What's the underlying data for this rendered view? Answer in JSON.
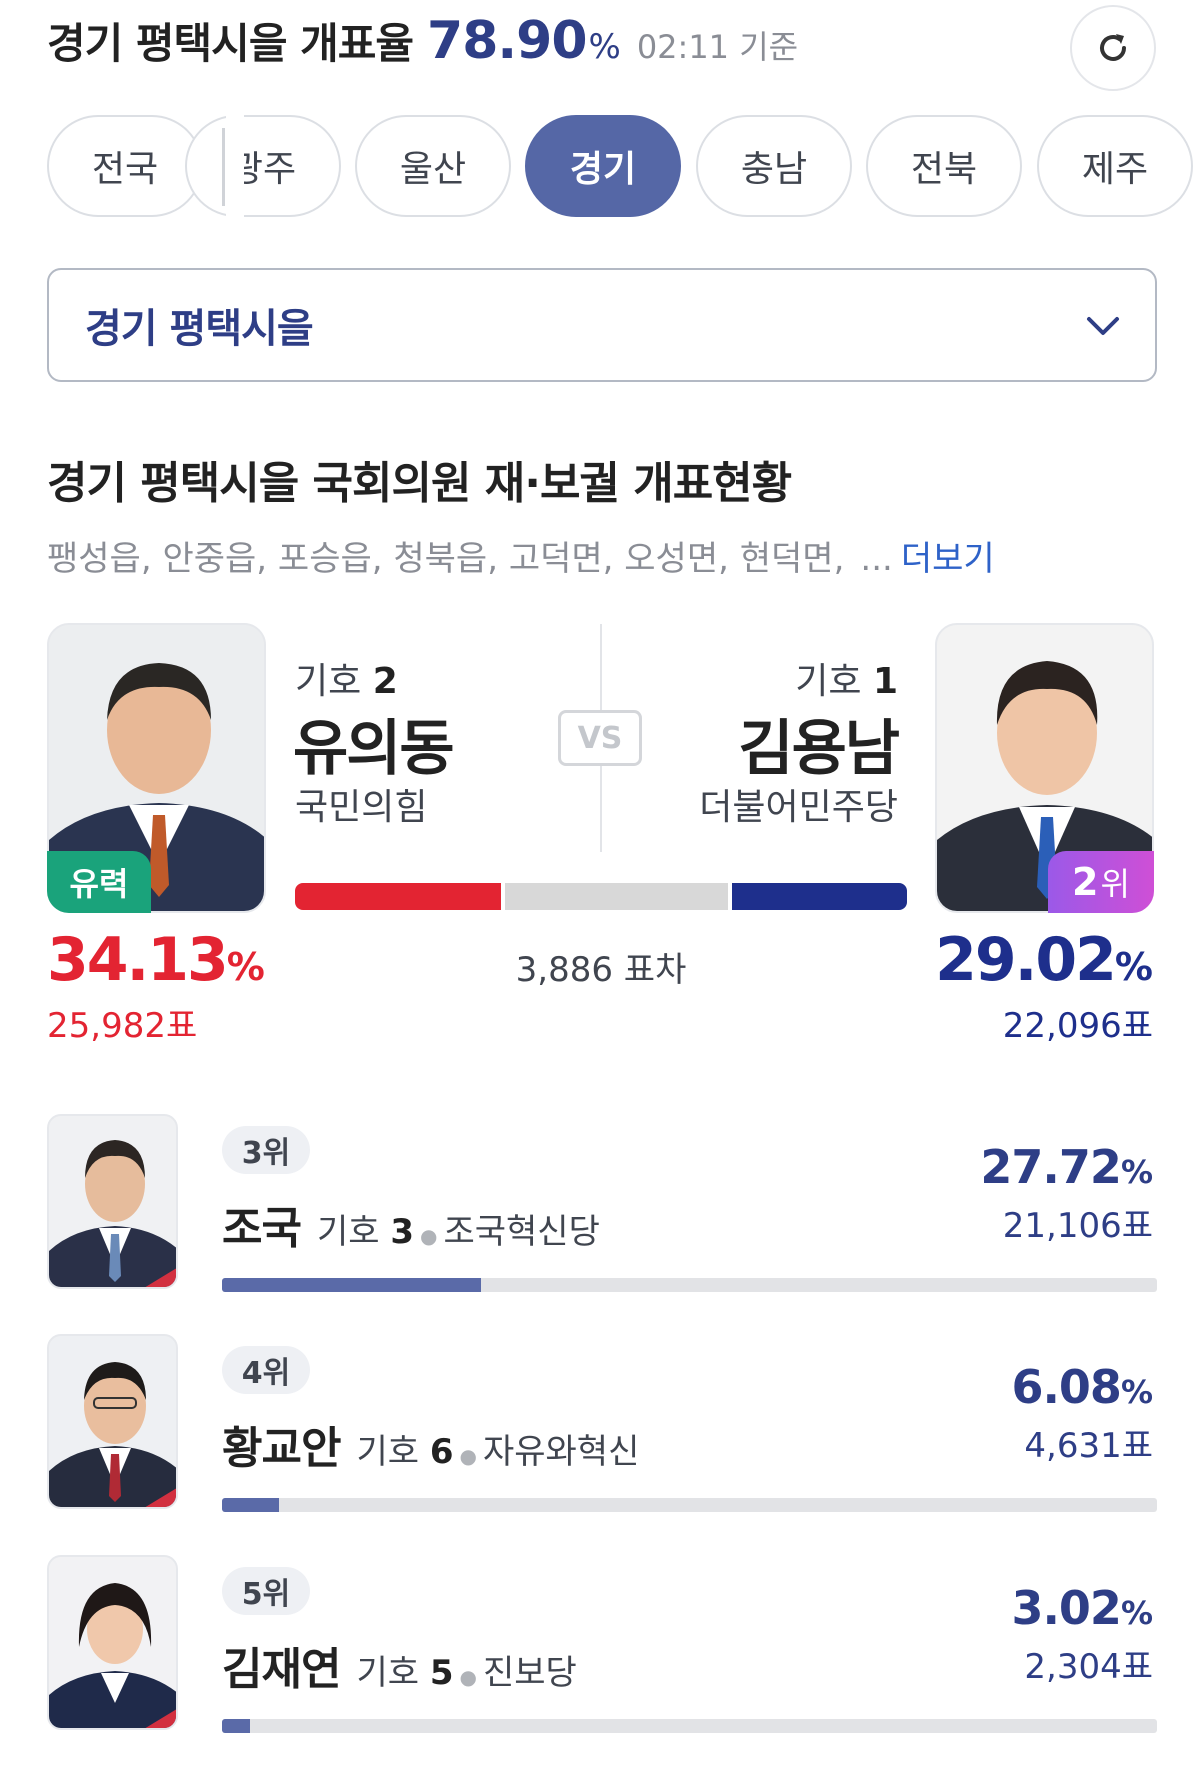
{
  "header": {
    "title": "경기 평택시을 개표율",
    "rate": "78.90",
    "rate_unit": "%",
    "time": "02:11 기준"
  },
  "tabs": [
    {
      "label": "전국",
      "active": false
    },
    {
      "label": "광주",
      "active": false
    },
    {
      "label": "울산",
      "active": false
    },
    {
      "label": "경기",
      "active": true
    },
    {
      "label": "충남",
      "active": false
    },
    {
      "label": "전북",
      "active": false
    },
    {
      "label": "제주",
      "active": false
    }
  ],
  "dropdown": {
    "selected": "경기 평택시을"
  },
  "section": {
    "title": "경기 평택시을 국회의원 재·보궐 개표현황",
    "areas": "팽성읍, 안중읍, 포승읍, 청북읍, 고덕면, 오성면, 현덕면,",
    "ellipsis": "...",
    "more": "더보기"
  },
  "leader": {
    "symbol_label": "기호",
    "symbol": "2",
    "name": "유의동",
    "party": "국민의힘",
    "badge": "유력",
    "percent": "34.13",
    "pct_unit": "%",
    "votes": "25,982표",
    "color": "#e32432"
  },
  "runner": {
    "symbol_label": "기호",
    "symbol": "1",
    "name": "김용남",
    "party": "더불어민주당",
    "badge_num": "2",
    "badge_unit": "위",
    "percent": "29.02",
    "pct_unit": "%",
    "votes": "22,096표",
    "color": "#1e2f8c"
  },
  "versus": {
    "vs": "VS",
    "diff": "3,886 표차",
    "bar_share": {
      "leader": 0.3413,
      "rest": 0.3685,
      "runner": 0.2902
    }
  },
  "others": [
    {
      "rank": "3위",
      "name": "조국",
      "symbol_label": "기호",
      "symbol": "3",
      "party": "조국혁신당",
      "percent": "27.72",
      "pct_unit": "%",
      "votes": "21,106표",
      "share": 0.2772
    },
    {
      "rank": "4위",
      "name": "황교안",
      "symbol_label": "기호",
      "symbol": "6",
      "party": "자유와혁신",
      "percent": "6.08",
      "pct_unit": "%",
      "votes": "4,631표",
      "share": 0.0608
    },
    {
      "rank": "5위",
      "name": "김재연",
      "symbol_label": "기호",
      "symbol": "5",
      "party": "진보당",
      "percent": "3.02",
      "pct_unit": "%",
      "votes": "2,304표",
      "share": 0.0302
    }
  ]
}
